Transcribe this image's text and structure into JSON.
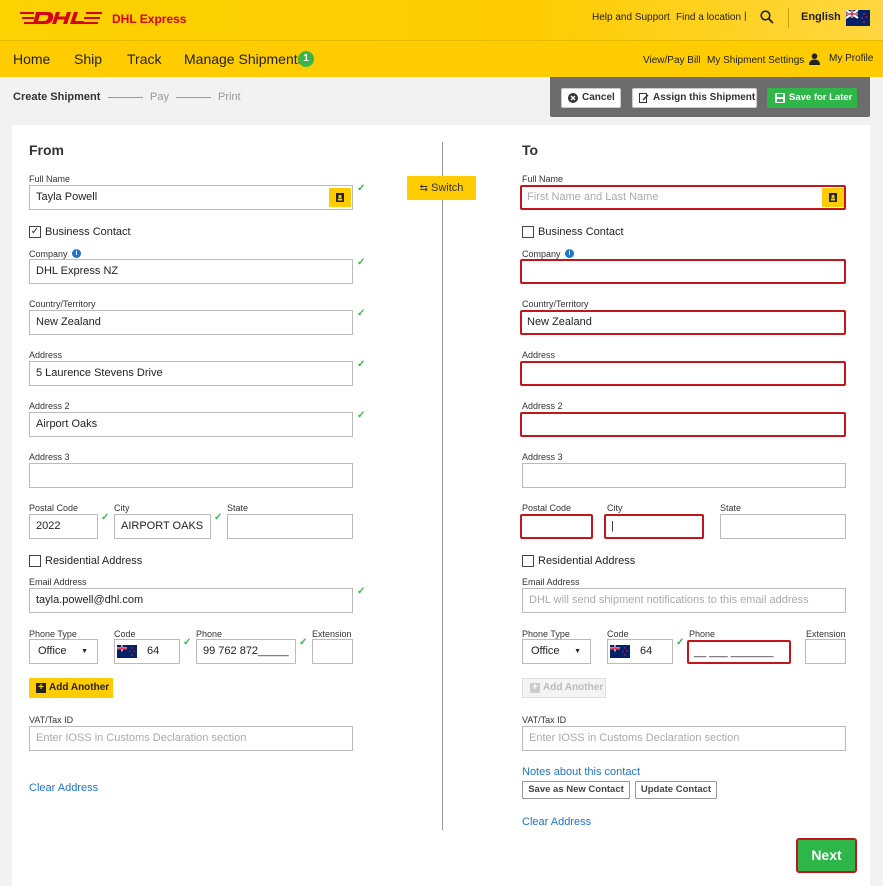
{
  "header": {
    "brand": "DHL Express",
    "help_link": "Help and Support",
    "find_location": "Find a location",
    "separator": "|",
    "language": "English"
  },
  "nav": {
    "items": [
      "Home",
      "Ship",
      "Track",
      "Manage Shipments"
    ],
    "badge_count": "1",
    "view_pay_bill": "View/Pay Bill",
    "shipment_settings": "My Shipment Settings",
    "my_profile": "My Profile"
  },
  "steps": {
    "create": "Create Shipment",
    "pay": "Pay",
    "print": "Print"
  },
  "actions": {
    "cancel": "Cancel",
    "assign": "Assign this Shipment",
    "save_later": "Save for Later"
  },
  "switch_label": "Switch",
  "labels": {
    "full_name": "Full Name",
    "business_contact": "Business Contact",
    "company": "Company",
    "country": "Country/Territory",
    "address": "Address",
    "address2": "Address 2",
    "address3": "Address 3",
    "postal_code": "Postal Code",
    "city": "City",
    "state": "State",
    "residential": "Residential Address",
    "email": "Email Address",
    "phone_type": "Phone Type",
    "code": "Code",
    "phone": "Phone",
    "extension": "Extension",
    "add_another": "Add Another",
    "vat": "VAT/Tax ID",
    "clear_address": "Clear Address"
  },
  "from": {
    "title": "From",
    "full_name": "Tayla Powell",
    "business_checked": "✓",
    "company": "DHL Express NZ",
    "country": "New Zealand",
    "address": "5 Laurence Stevens Drive",
    "address2": "Airport Oaks",
    "address3": "",
    "postal_code": "2022",
    "city": "AIRPORT OAKS",
    "state": "",
    "email": "tayla.powell@dhl.com",
    "phone_type": "Office",
    "code": "64",
    "phone": "99 762 872_____",
    "extension": "",
    "vat_placeholder": "Enter IOSS in Customs Declaration section"
  },
  "to": {
    "title": "To",
    "full_name_placeholder": "First Name and Last Name",
    "company": "",
    "country": "New Zealand",
    "address": "",
    "address2": "",
    "address3": "",
    "postal_code": "",
    "city": "|",
    "state": "",
    "email_placeholder": "DHL will send shipment notifications to this email address",
    "phone_type": "Office",
    "code": "64",
    "phone": "__ ___ _______",
    "extension": "",
    "vat_placeholder": "Enter IOSS in Customs Declaration section",
    "notes_link": "Notes about this contact",
    "save_new_contact": "Save as New Contact",
    "update_contact": "Update Contact"
  },
  "next_button": "Next",
  "colors": {
    "dhl_yellow": "#fecc00",
    "dhl_red": "#d40511",
    "green": "#2eb648",
    "error_red": "#c4151c",
    "link_blue": "#1d75c9"
  }
}
